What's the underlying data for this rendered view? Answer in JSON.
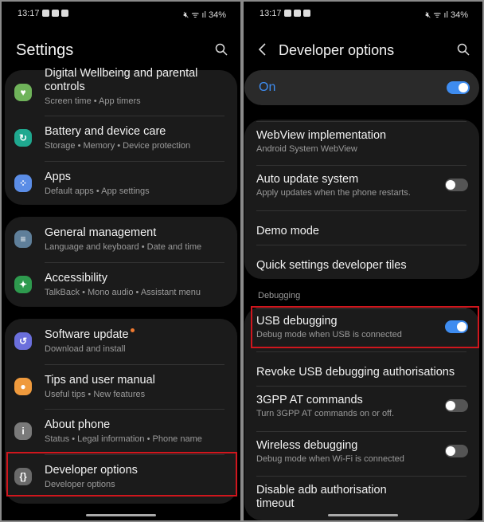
{
  "status": {
    "time": "13:17",
    "battery": "34%"
  },
  "left": {
    "title": "Settings",
    "groups": [
      [
        {
          "title": "Digital Wellbeing and parental controls",
          "title1": "Digital Wellbeing and parental",
          "title2": "controls",
          "sub": "Screen time  •  App timers",
          "icon": "wellbeing-icon",
          "color": "#6fb35a"
        },
        {
          "title": "Battery and device care",
          "sub": "Storage  •  Memory  •  Device protection",
          "icon": "device-care-icon",
          "color": "#1fa88f"
        },
        {
          "title": "Apps",
          "sub": "Default apps  •  App settings",
          "icon": "apps-icon",
          "color": "#5b8de6"
        }
      ],
      [
        {
          "title": "General management",
          "sub": "Language and keyboard  •  Date and time",
          "icon": "sliders-icon",
          "color": "#5f7f9a"
        },
        {
          "title": "Accessibility",
          "sub": "TalkBack  •  Mono audio  •  Assistant menu",
          "icon": "accessibility-icon",
          "color": "#2e9a4e"
        }
      ],
      [
        {
          "title": "Software update",
          "sub": "Download and install",
          "icon": "software-update-icon",
          "color": "#6b6fdc"
        },
        {
          "title": "Tips and user manual",
          "sub": "Useful tips  •  New features",
          "icon": "lightbulb-icon",
          "color": "#ef9a3d"
        },
        {
          "title": "About phone",
          "sub": "Status  •  Legal information  •  Phone name",
          "icon": "info-icon",
          "color": "#7a7a7a"
        },
        {
          "title": "Developer options",
          "sub": "Developer options",
          "icon": "code-braces-icon",
          "color": "#6a6a6a"
        }
      ]
    ]
  },
  "right": {
    "title": "Developer options",
    "master": {
      "label": "On",
      "on": true
    },
    "items": [
      {
        "title": "WebView implementation",
        "sub": "Android System WebView"
      },
      {
        "title": "Auto update system",
        "sub": "Apply updates when the phone restarts.",
        "toggle": false
      },
      {
        "title": "Demo mode"
      },
      {
        "title": "Quick settings developer tiles"
      }
    ],
    "section": "Debugging",
    "debug": [
      {
        "title": "USB debugging",
        "sub": "Debug mode when USB is connected",
        "toggle": true
      },
      {
        "title": "Revoke USB debugging authorisations"
      },
      {
        "title": "3GPP AT commands",
        "sub": "Turn 3GPP AT commands on or off.",
        "toggle": false
      },
      {
        "title": "Wireless debugging",
        "sub": "Debug mode when Wi-Fi is connected",
        "toggle": false
      },
      {
        "title": "Disable adb authorisation timeout",
        "title1": "Disable adb authorisation",
        "title2": "timeout"
      }
    ]
  },
  "colors": {
    "accent": "#3e8cf0",
    "highlight": "#d0161d",
    "badge": "#f07a30"
  }
}
